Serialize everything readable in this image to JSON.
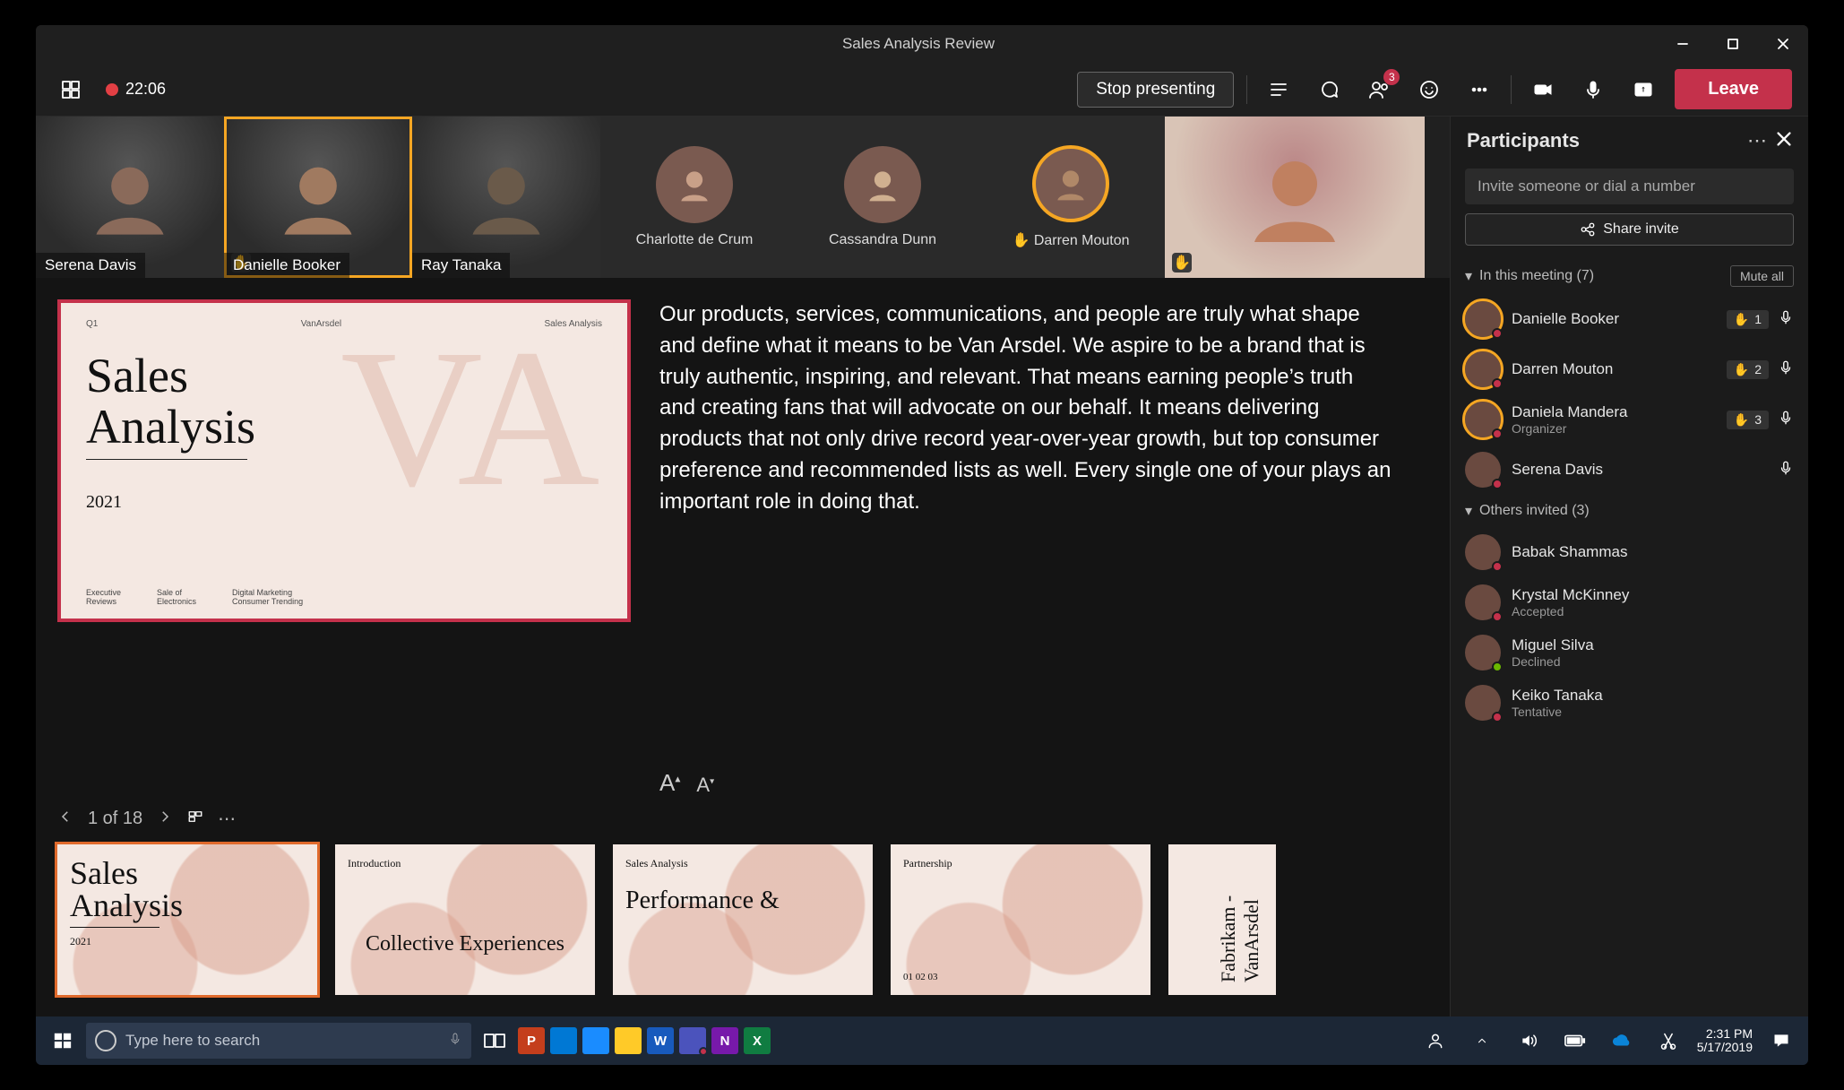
{
  "window": {
    "title": "Sales Analysis Review"
  },
  "toolbar": {
    "recording_time": "22:06",
    "stop_presenting": "Stop presenting",
    "leave": "Leave",
    "people_badge": "3"
  },
  "video_row": [
    {
      "name": "Serena Davis",
      "kind": "video",
      "speaking": false,
      "hand": false
    },
    {
      "name": "Danielle Booker",
      "kind": "video",
      "speaking": true,
      "hand": true
    },
    {
      "name": "Ray Tanaka",
      "kind": "video",
      "speaking": false,
      "hand": false
    },
    {
      "name": "Charlotte de Crum",
      "kind": "avatar",
      "speaking": false,
      "hand": false
    },
    {
      "name": "Cassandra Dunn",
      "kind": "avatar",
      "speaking": false,
      "hand": false
    },
    {
      "name": "Darren Mouton",
      "kind": "avatar",
      "speaking": false,
      "hand": true,
      "ring": true
    },
    {
      "name": "",
      "kind": "video",
      "speaking": false,
      "hand": true,
      "wide": true
    }
  ],
  "slide": {
    "title_line1": "Sales",
    "title_line2": "Analysis",
    "year": "2021",
    "top_left": "Q1",
    "top_center": "VanArsdel",
    "top_right": "Sales Analysis",
    "col1a": "Executive",
    "col1b": "Reviews",
    "col2a": "Sale of",
    "col2b": "Electronics",
    "col3a": "Digital Marketing",
    "col3b": "Consumer Trending"
  },
  "notes_text": "Our products, services, communications, and people are truly what shape and define what it means to be Van Arsdel. We aspire to be a brand that is truly authentic, inspiring, and relevant. That means earning people’s truth and creating fans that will advocate on our behalf. It means delivering products that not only drive record year-over-year growth, but top consumer preference and recommended lists as well. Every single one of your plays an important role in doing that.",
  "slide_nav": {
    "position": "1 of 18"
  },
  "thumbs": [
    {
      "n": "1",
      "title": "Sales\nAnalysis",
      "sub": "2021",
      "selected": true
    },
    {
      "n": "2",
      "title": "Introduction",
      "center": "Collective Experiences"
    },
    {
      "n": "3",
      "title": "Sales Analysis",
      "center": "Performance &"
    },
    {
      "n": "4",
      "title": "Partnership",
      "footer": "01 02 03"
    },
    {
      "n": "5",
      "rot": "Fabrikam - VanArsdel"
    }
  ],
  "participants_panel": {
    "title": "Participants",
    "invite_placeholder": "Invite someone or dial a number",
    "share_invite": "Share invite",
    "in_meeting_label": "In this meeting (7)",
    "mute_all": "Mute all",
    "in_meeting": [
      {
        "name": "Danielle Booker",
        "hand_order": "1",
        "handed": true,
        "mic": true,
        "presence": "busy"
      },
      {
        "name": "Darren Mouton",
        "hand_order": "2",
        "handed": true,
        "mic": true,
        "presence": "busy"
      },
      {
        "name": "Daniela Mandera",
        "sub": "Organizer",
        "hand_order": "3",
        "handed": true,
        "mic": true,
        "presence": "busy"
      },
      {
        "name": "Serena Davis",
        "handed": false,
        "mic": true,
        "presence": "busy"
      }
    ],
    "others_label": "Others invited (3)",
    "others": [
      {
        "name": "Babak Shammas",
        "sub": "",
        "presence": "busy"
      },
      {
        "name": "Krystal McKinney",
        "sub": "Accepted",
        "presence": "busy"
      },
      {
        "name": "Miguel Silva",
        "sub": "Declined",
        "presence": "available"
      },
      {
        "name": "Keiko Tanaka",
        "sub": "Tentative",
        "presence": "busy"
      }
    ]
  },
  "taskbar": {
    "search_placeholder": "Type here to search",
    "time": "2:31 PM",
    "date": "5/17/2019"
  }
}
